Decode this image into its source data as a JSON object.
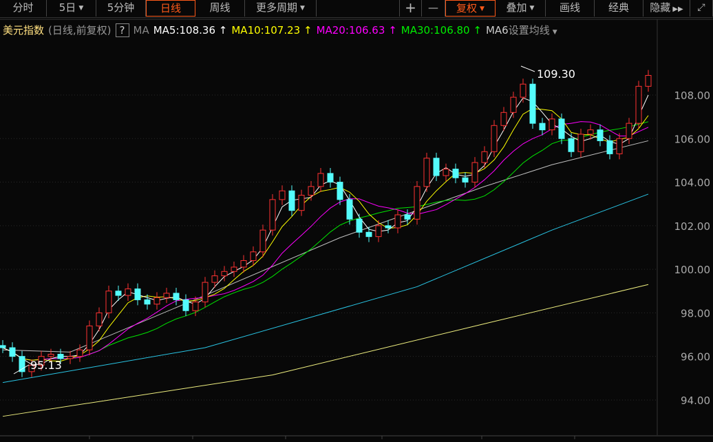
{
  "toolbar": {
    "items": [
      {
        "label": "分时"
      },
      {
        "label": "5日"
      },
      {
        "label": "5分钟"
      },
      {
        "label": "日线"
      },
      {
        "label": "周线"
      },
      {
        "label": "更多周期"
      }
    ],
    "right": [
      {
        "label": "+"
      },
      {
        "label": "—"
      },
      {
        "label": "复权"
      },
      {
        "label": "叠加"
      },
      {
        "label": "画线"
      },
      {
        "label": "经典"
      },
      {
        "label": "隐藏"
      }
    ],
    "active": "日线"
  },
  "legend": {
    "name": "美元指数",
    "mode": "(日线,前复权)",
    "help": "?",
    "ma": "MA",
    "ma5": "MA5:108.36",
    "ma10": "MA10:107.23",
    "ma20": "MA20:106.63",
    "ma30": "MA30:106.80",
    "ma60": "MA6",
    "set": "设置均线",
    "arrow": "↑"
  },
  "colors": {
    "up": "#ff3232",
    "down": "#54fcfc",
    "ma5": "#ffffff",
    "ma10": "#ffff00",
    "ma20": "#ff00ff",
    "ma30": "#00e600",
    "ma60": "#c0c0c0",
    "ma120": "#29c6e6",
    "ma250": "#f0f080"
  },
  "chart_data": {
    "type": "candlestick",
    "y_ticks": [
      "108.00",
      "106.00",
      "104.00",
      "102.00",
      "100.00",
      "98.00",
      "96.00",
      "94.00"
    ],
    "ylim": [
      93.4,
      110
    ],
    "annotations": {
      "high": "109.30",
      "low": "95.13"
    },
    "closes": [
      96.4,
      96.0,
      95.3,
      95.6,
      96.0,
      96.1,
      95.9,
      96.0,
      96.3,
      97.4,
      98.0,
      99.0,
      98.8,
      99.1,
      98.6,
      98.4,
      98.7,
      98.9,
      98.6,
      98.1,
      98.5,
      99.4,
      99.7,
      99.9,
      100.1,
      100.4,
      100.8,
      101.8,
      103.2,
      103.6,
      102.7,
      103.4,
      103.8,
      104.4,
      104.0,
      103.2,
      102.3,
      101.7,
      101.5,
      102.0,
      101.9,
      102.5,
      102.3,
      103.8,
      105.1,
      104.3,
      104.6,
      104.2,
      104.0,
      104.9,
      105.4,
      106.6,
      107.2,
      107.9,
      108.5,
      106.7,
      106.4,
      106.9,
      106.0,
      105.4,
      106.2,
      106.4,
      105.9,
      105.3,
      106.0,
      106.7,
      108.4,
      108.9
    ],
    "long_ma": [
      {
        "key": "ma60",
        "points": [
          [
            0,
            96.3
          ],
          [
            7,
            96.2
          ],
          [
            21,
            98.8
          ],
          [
            35,
            101.45
          ],
          [
            50,
            103.8
          ],
          [
            57,
            104.8
          ],
          [
            67,
            105.9
          ]
        ]
      },
      {
        "key": "ma120",
        "points": [
          [
            0,
            94.8
          ],
          [
            21,
            96.4
          ],
          [
            43,
            99.2
          ],
          [
            57,
            101.8
          ],
          [
            67,
            103.45
          ]
        ]
      },
      {
        "key": "ma250",
        "points": [
          [
            0,
            93.25
          ],
          [
            28,
            95.15
          ],
          [
            50,
            97.5
          ],
          [
            67,
            99.3
          ]
        ]
      }
    ]
  }
}
